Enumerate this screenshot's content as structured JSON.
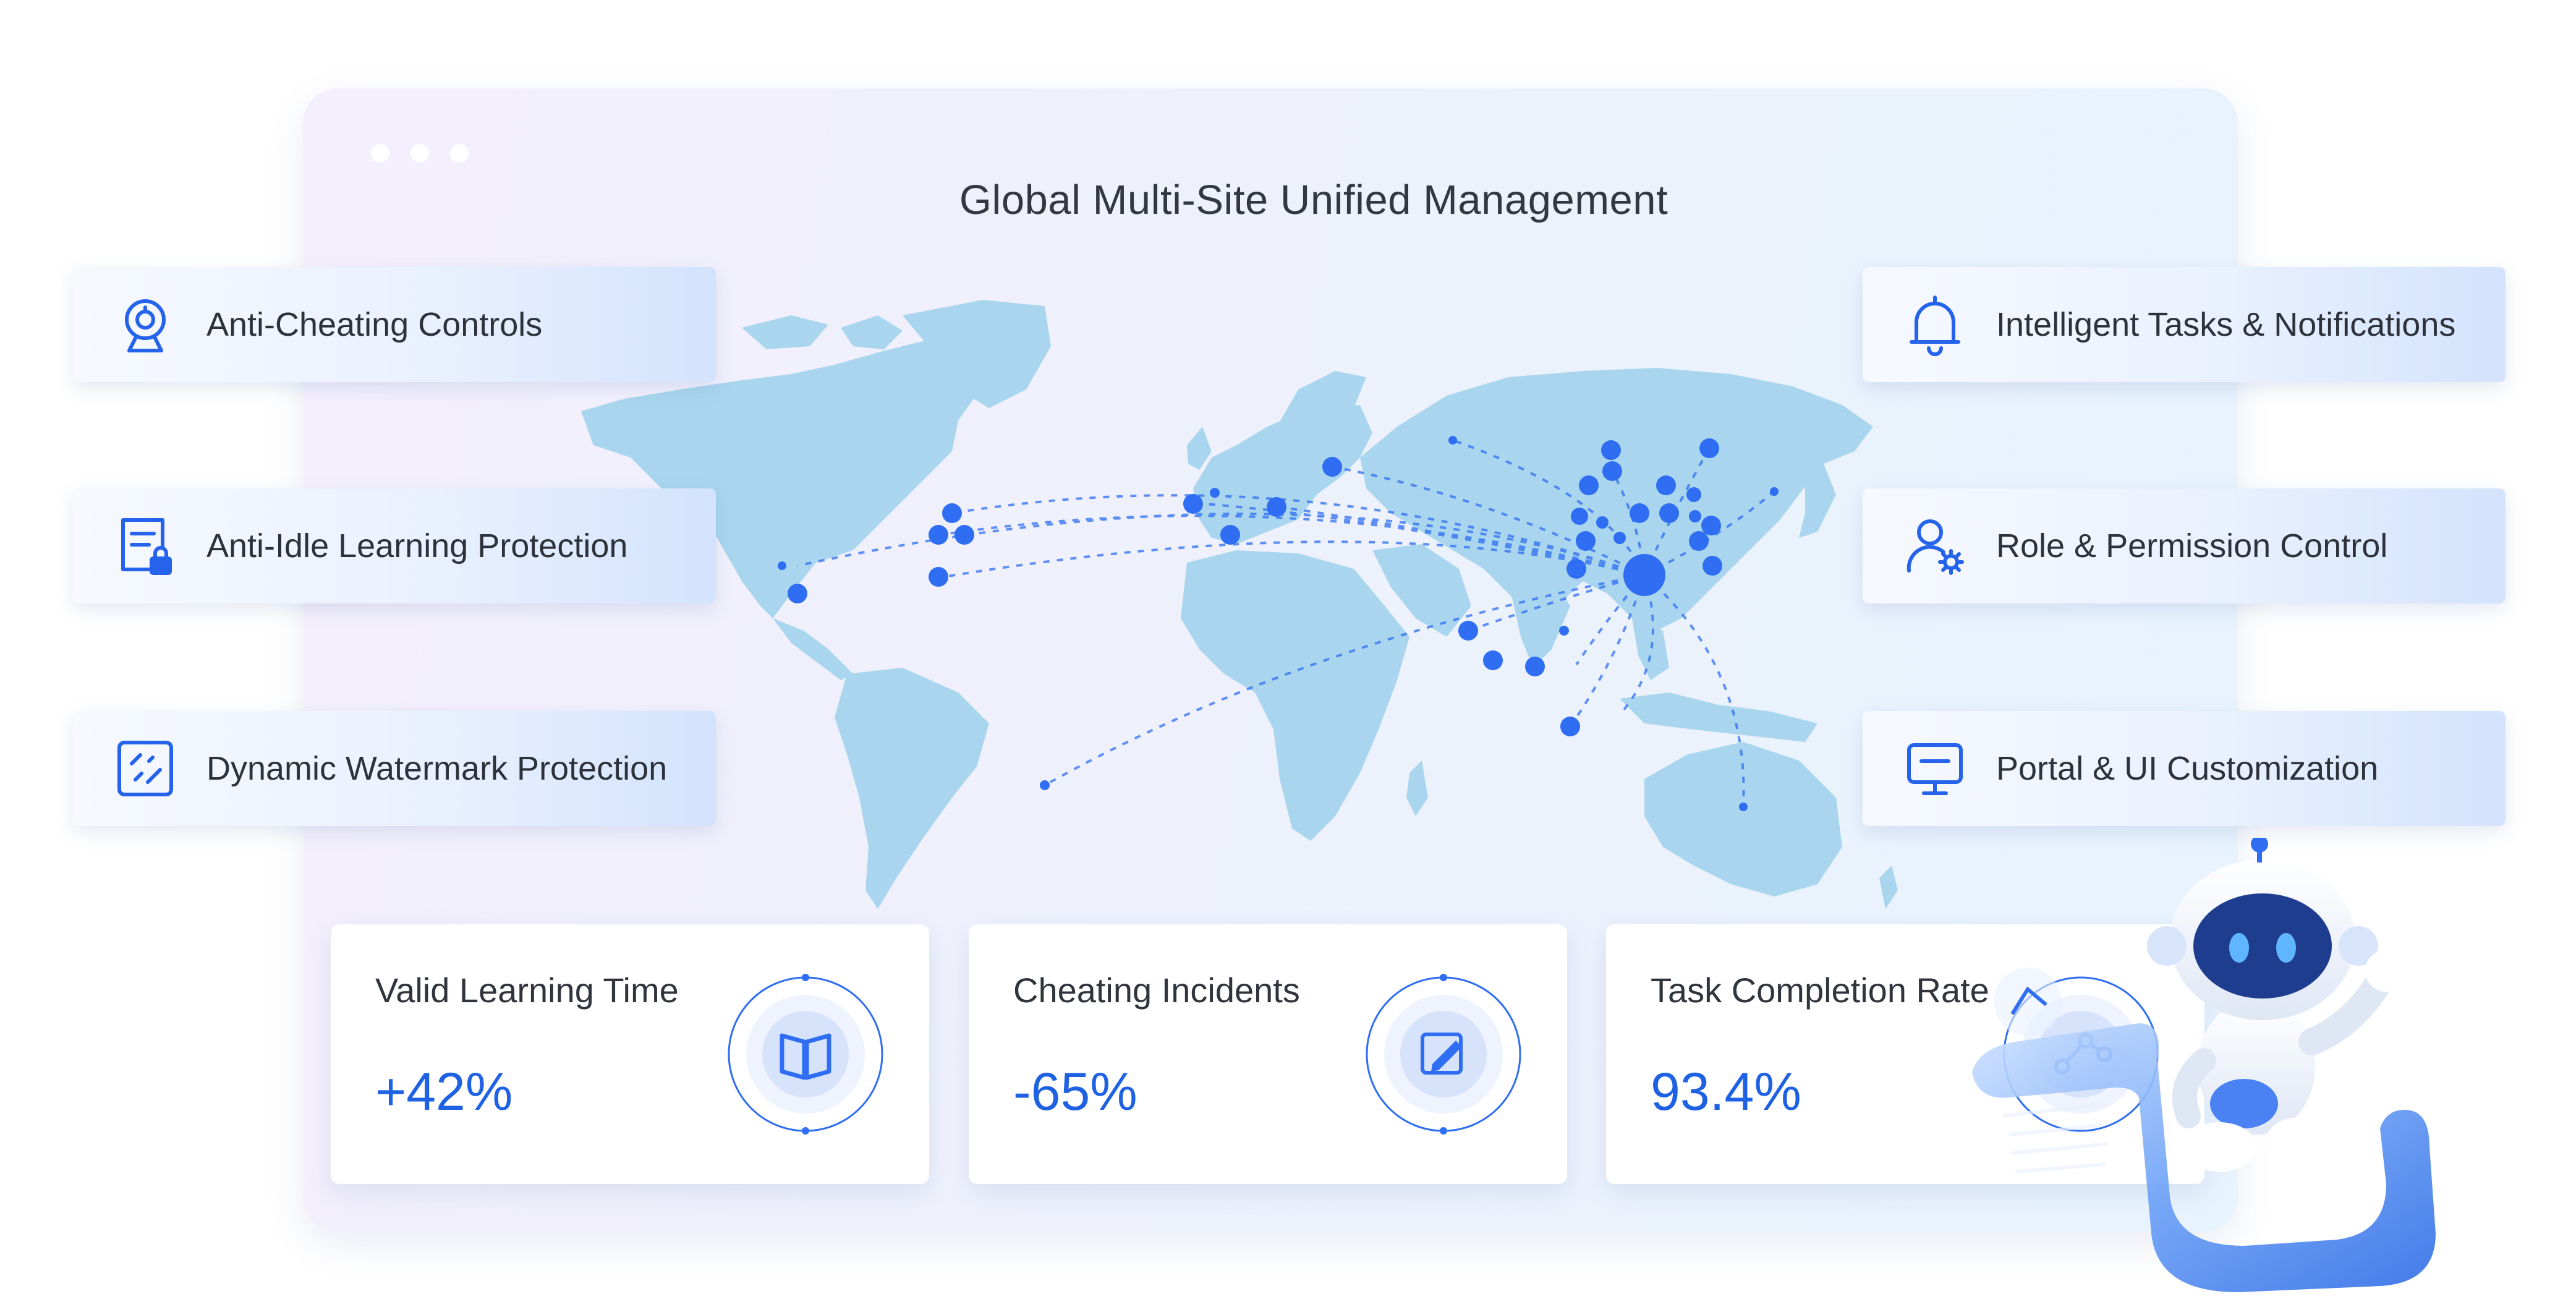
{
  "window": {
    "title": "Global Multi-Site Unified Management"
  },
  "features_left": [
    {
      "label": "Anti-Cheating Controls",
      "icon": "webcam-icon"
    },
    {
      "label": "Anti-Idle Learning Protection",
      "icon": "locked-document-icon"
    },
    {
      "label": "Dynamic Watermark Protection",
      "icon": "watermark-icon"
    }
  ],
  "features_right": [
    {
      "label": "Intelligent Tasks & Notifications",
      "icon": "bell-icon"
    },
    {
      "label": "Role & Permission Control",
      "icon": "user-settings-icon"
    },
    {
      "label": "Portal & UI Customization",
      "icon": "monitor-icon"
    }
  ],
  "stats": [
    {
      "label": "Valid Learning Time",
      "value": "+42%",
      "icon": "book-icon"
    },
    {
      "label": "Cheating Incidents",
      "value": "-65%",
      "icon": "edit-icon"
    },
    {
      "label": "Task Completion Rate",
      "value": "93.4%",
      "icon": "network-icon"
    }
  ],
  "theme": {
    "accent": "#1e62e3",
    "map_land": "#a9d6ee",
    "dot": "#2f6ef2",
    "panel_start": "#f4effc",
    "panel_end": "#e7f3fd"
  }
}
